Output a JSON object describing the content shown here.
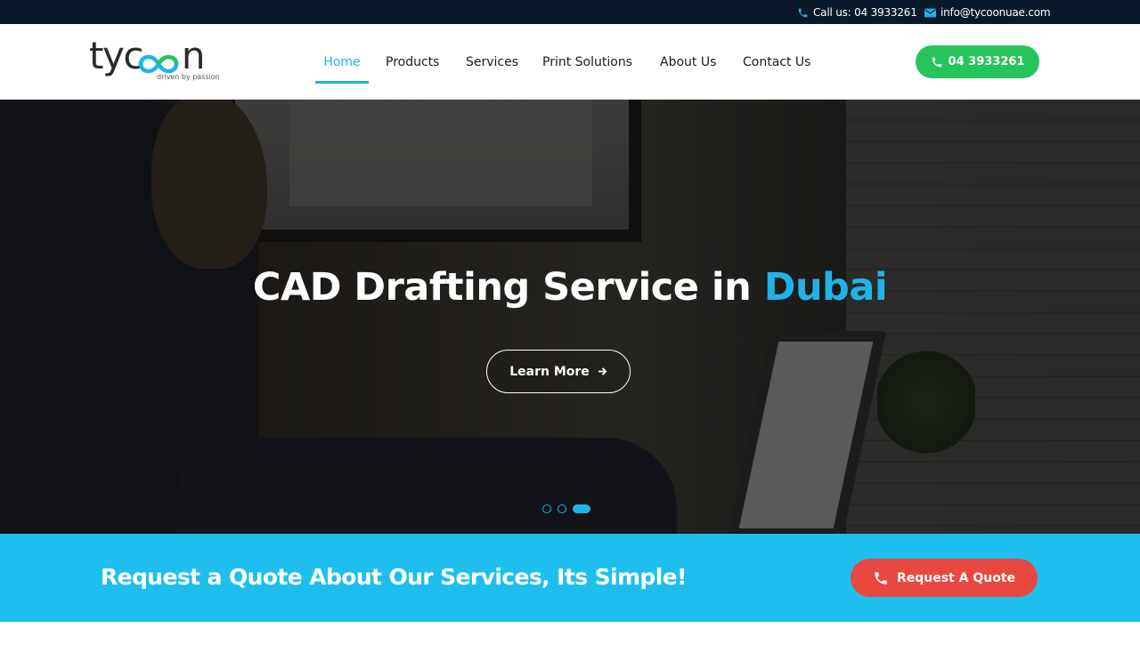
{
  "topbar": {
    "call_text": "Call us: 04 3933261",
    "email_text": "info@tycoonuae.com",
    "icons": {
      "call": "phone-icon",
      "email": "envelope-icon"
    }
  },
  "header": {
    "logo": {
      "word_start": "tyc",
      "word_end": "n",
      "tagline": "driven by passion"
    },
    "nav": [
      {
        "label": "Home",
        "active": true
      },
      {
        "label": "Products",
        "active": false
      },
      {
        "label": "Services",
        "active": false
      },
      {
        "label": "Print Solutions",
        "active": false
      },
      {
        "label": "About Us",
        "active": false
      },
      {
        "label": "Contact Us",
        "active": false
      }
    ],
    "phone_button": "04 3933261"
  },
  "hero": {
    "title_main": "CAD Drafting Service in ",
    "title_accent": "Dubai",
    "cta_label": "Learn More",
    "slides_total": 3,
    "slide_active": 3
  },
  "quote_band": {
    "message": "Request a Quote About Our Services, Its Simple!",
    "button_label": "Request A Quote"
  },
  "colors": {
    "accent": "#1fb3e8",
    "topbar_bg": "#0a1a2a",
    "phone_green": "#27c45c",
    "band_bg": "#1ebfef",
    "quote_red": "#e8483f"
  }
}
